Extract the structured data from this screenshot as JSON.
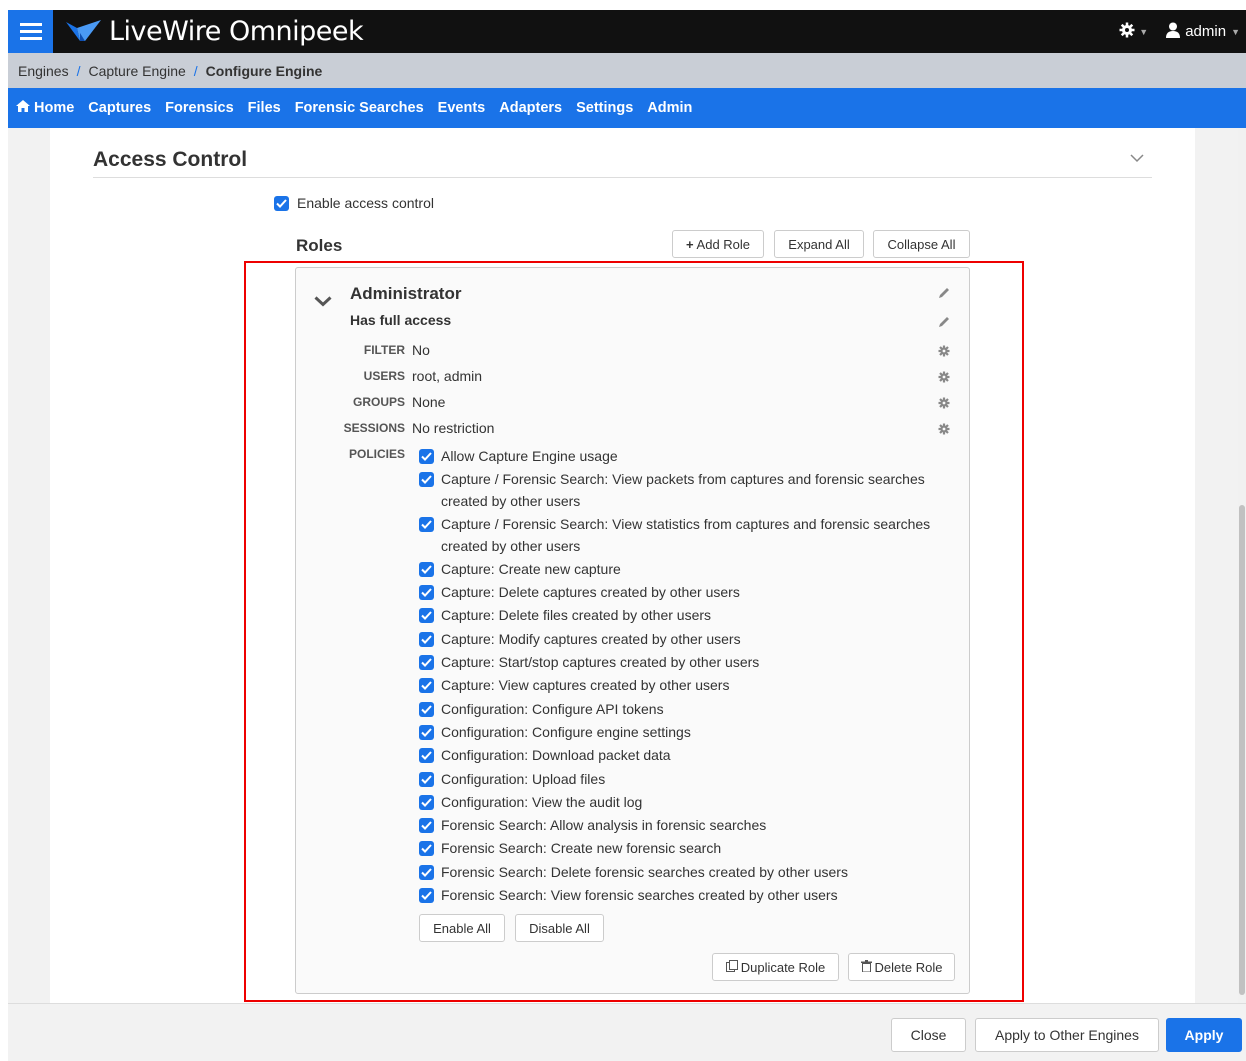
{
  "app": {
    "title": "LiveWire Omnipeek",
    "user": "admin"
  },
  "breadcrumb": [
    "Engines",
    "Capture Engine",
    "Configure Engine"
  ],
  "nav": [
    "Home",
    "Captures",
    "Forensics",
    "Files",
    "Forensic Searches",
    "Events",
    "Adapters",
    "Settings",
    "Admin"
  ],
  "section": {
    "title": "Access Control",
    "enable_label": "Enable access control",
    "enabled": true
  },
  "roles": {
    "title": "Roles",
    "add_role": "Add Role",
    "expand_all": "Expand All",
    "collapse_all": "Collapse All"
  },
  "role": {
    "name": "Administrator",
    "description": "Has full access",
    "fields": [
      {
        "label": "FILTER",
        "value": "No"
      },
      {
        "label": "USERS",
        "value": "root, admin"
      },
      {
        "label": "GROUPS",
        "value": "None"
      },
      {
        "label": "SESSIONS",
        "value": "No restriction"
      }
    ],
    "policies_label": "POLICIES",
    "policies": [
      "Allow Capture Engine usage",
      "Capture / Forensic Search: View packets from captures and forensic searches created by other users",
      "Capture / Forensic Search: View statistics from captures and forensic searches created by other users",
      "Capture: Create new capture",
      "Capture: Delete captures created by other users",
      "Capture: Delete files created by other users",
      "Capture: Modify captures created by other users",
      "Capture: Start/stop captures created by other users",
      "Capture: View captures created by other users",
      "Configuration: Configure API tokens",
      "Configuration: Configure engine settings",
      "Configuration: Download packet data",
      "Configuration: Upload files",
      "Configuration: View the audit log",
      "Forensic Search: Allow analysis in forensic searches",
      "Forensic Search: Create new forensic search",
      "Forensic Search: Delete forensic searches created by other users",
      "Forensic Search: View forensic searches created by other users"
    ],
    "enable_all": "Enable All",
    "disable_all": "Disable All",
    "duplicate_role": "Duplicate Role",
    "delete_role": "Delete Role"
  },
  "footer": {
    "close": "Close",
    "apply_other": "Apply to Other Engines",
    "apply": "Apply"
  },
  "colors": {
    "accent": "#1a73e8",
    "topbar": "#111111",
    "breadcrumb_bg": "#c9ced6",
    "highlight": "#ee0000"
  }
}
